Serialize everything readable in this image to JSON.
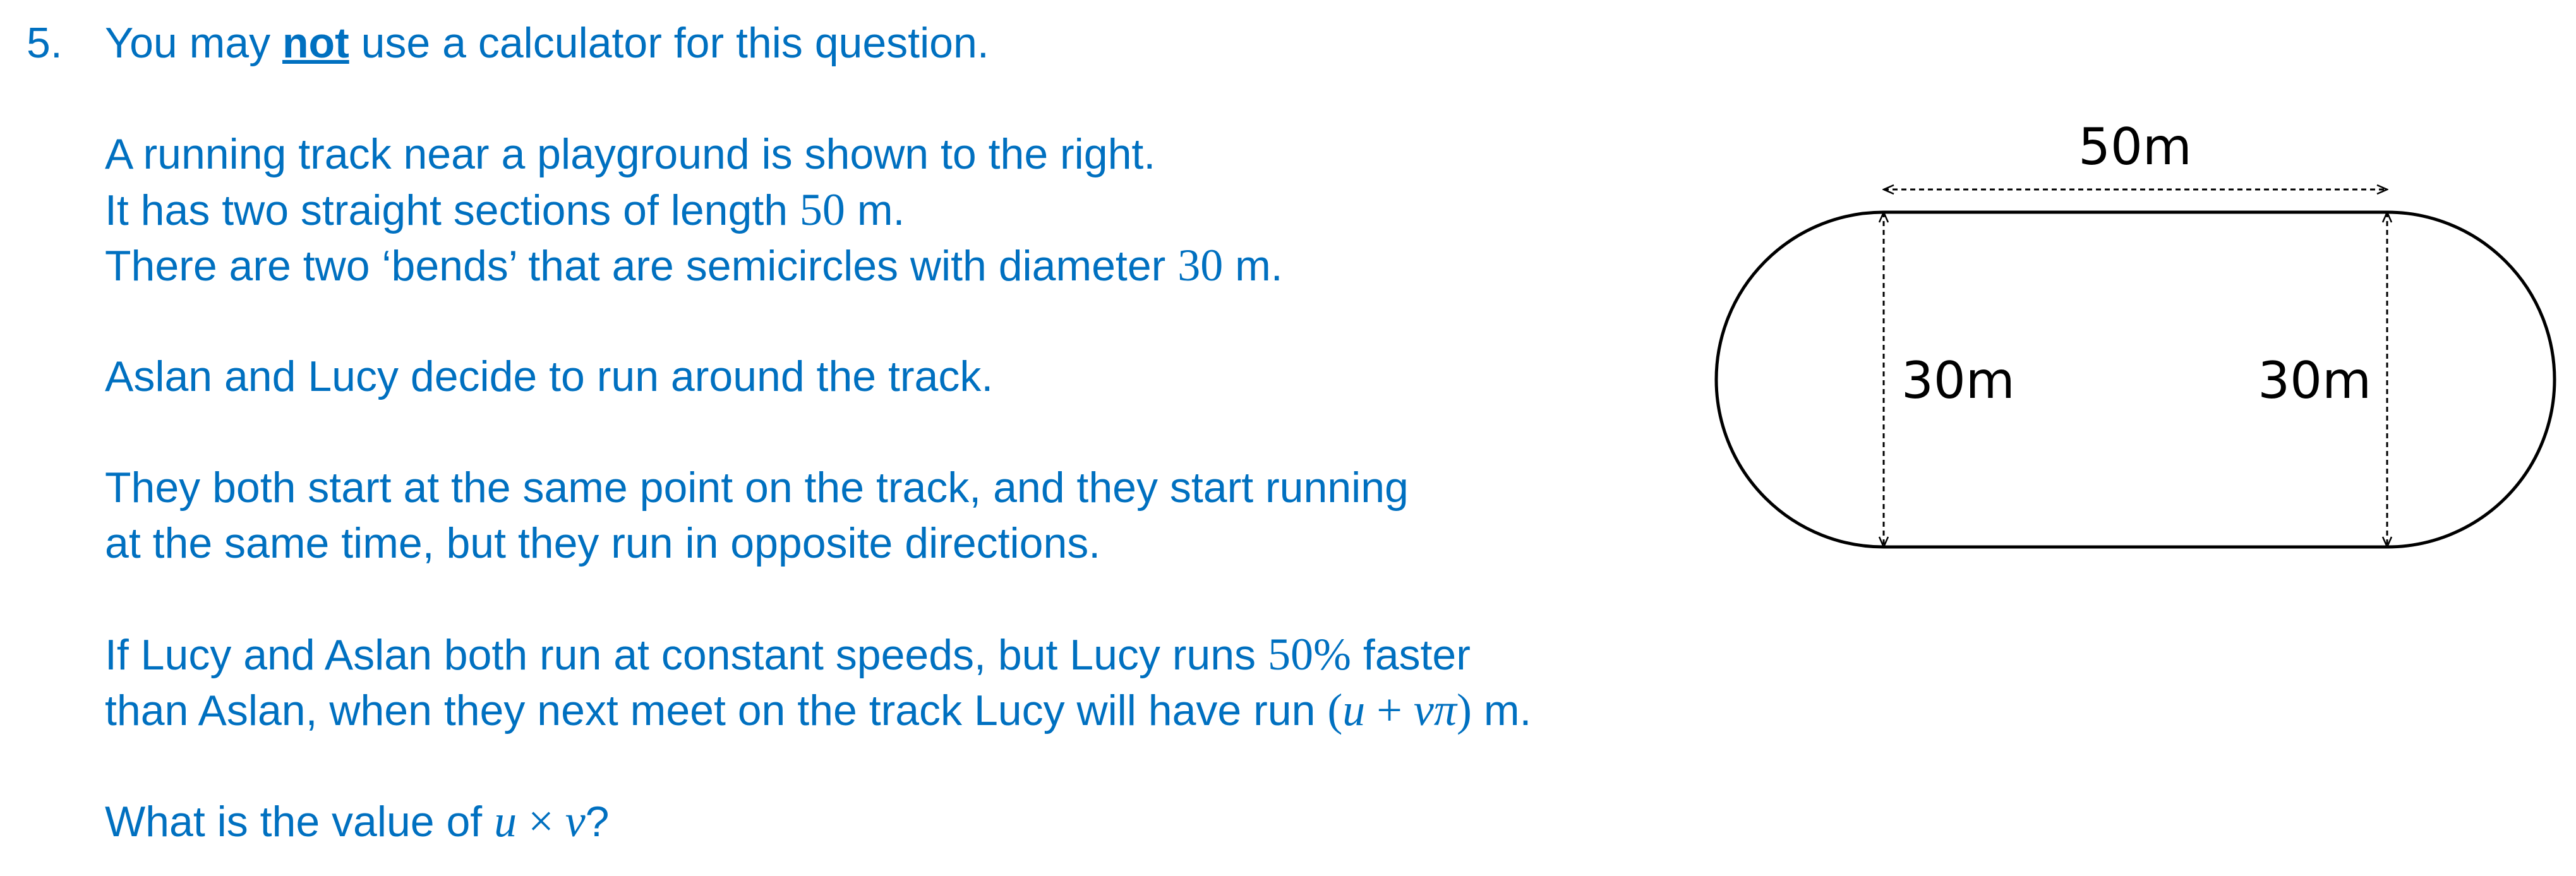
{
  "question": {
    "number": "5.",
    "instruction_before": "You may ",
    "instruction_emphasis": "not",
    "instruction_after": " use a calculator for this question.",
    "line1": "A running track near a playground is shown to the right.",
    "line2_before": "It has two straight sections of length ",
    "line2_value": "50",
    "line2_after": " m.",
    "line3_before": "There are two ‘bends’ that are semicircles with diameter ",
    "line3_value": "30",
    "line3_after": " m.",
    "line4": "Aslan and Lucy decide to run around the track.",
    "line5": "They both start at the same point on the track, and they start running",
    "line6": "at the same time, but they run in opposite directions.",
    "line7_before": "If Lucy and Aslan both run at constant speeds, but Lucy runs ",
    "line7_value": "50%",
    "line7_after": " faster",
    "line8_before": "than Aslan, when they next meet on the track Lucy will have run ",
    "line8_expr_open": "(",
    "line8_u": "u",
    "line8_plus": " + ",
    "line8_v": "v",
    "line8_pi": "π",
    "line8_expr_close": ")",
    "line8_after": " m.",
    "line9_before": "What is the value of ",
    "line9_u": "u",
    "line9_times": " × ",
    "line9_v": "v",
    "line9_after": "?"
  },
  "diagram": {
    "top_label": "50m",
    "left_label": "30m",
    "right_label": "30m"
  },
  "colors": {
    "text": "#0070C0",
    "diagram": "#000000"
  }
}
